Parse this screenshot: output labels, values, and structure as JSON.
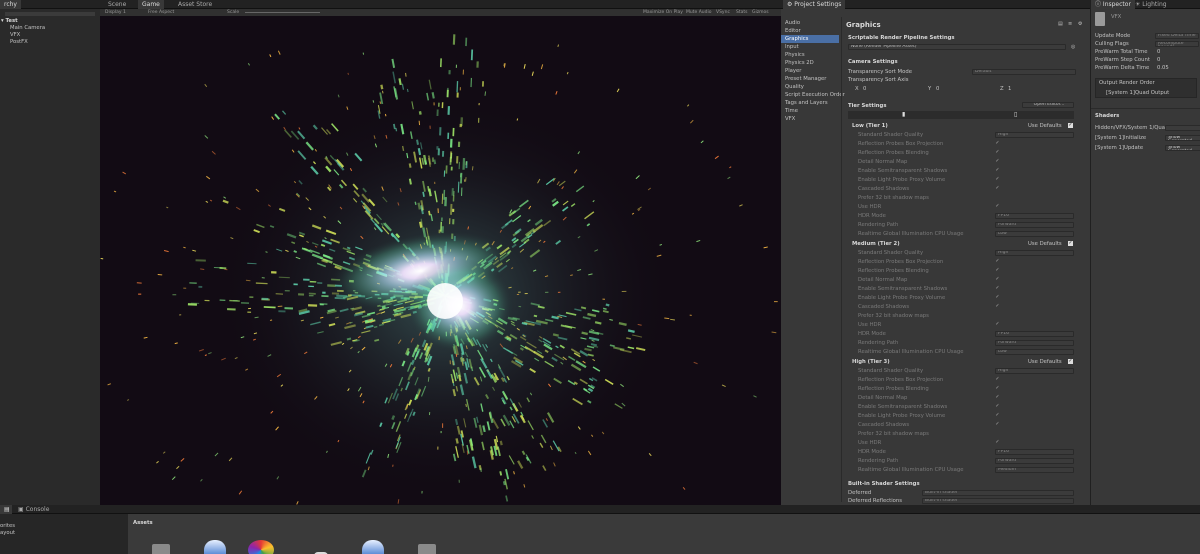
{
  "hierarchy": {
    "tab": "rchy",
    "scene_name": "Test",
    "items": [
      "Main Camera",
      "VFX",
      "PostFX"
    ]
  },
  "center_tabs": {
    "scene": "Scene",
    "game": "Game",
    "asset_store": "Asset Store"
  },
  "game_toolbar": {
    "display": "Display 1",
    "aspect": "Free Aspect",
    "scale_label": "Scale",
    "maximize": "Maximize On Play",
    "mute": "Mute Audio",
    "vsync": "VSync",
    "stats": "Stats",
    "gizmos": "Gizmos"
  },
  "project_settings": {
    "tab": "Project Settings",
    "categories": [
      "Audio",
      "Editor",
      "Graphics",
      "Input",
      "Physics",
      "Physics 2D",
      "Player",
      "Preset Manager",
      "Quality",
      "Script Execution Order",
      "Tags and Layers",
      "Time",
      "VFX"
    ],
    "selected_index": 2,
    "header": "Graphics",
    "srp_section": "Scriptable Render Pipeline Settings",
    "srp_value": "None (Render Pipeline Asset)",
    "camera_section": "Camera Settings",
    "transparency_sort_mode_label": "Transparency Sort Mode",
    "transparency_sort_mode_value": "Default",
    "transparency_sort_axis_label": "Transparency Sort Axis",
    "axis": {
      "x_label": "X",
      "x_value": "0",
      "y_label": "Y",
      "y_value": "0",
      "z_label": "Z",
      "z_value": "1"
    },
    "tier_section": "Tier Settings",
    "open_editor": "Open Editor...",
    "use_defaults": "Use Defaults",
    "tiers": [
      {
        "name": "Low (Tier 1)",
        "rows": [
          {
            "label": "Standard Shader Quality",
            "value": "High"
          },
          {
            "label": "Reflection Probes Box Projection",
            "check": true
          },
          {
            "label": "Reflection Probes Blending",
            "check": true
          },
          {
            "label": "Detail Normal Map",
            "check": true
          },
          {
            "label": "Enable Semitransparent Shadows",
            "check": true
          },
          {
            "label": "Enable Light Probe Proxy Volume",
            "check": true
          },
          {
            "label": "Cascaded Shadows",
            "check": true
          },
          {
            "label": "Prefer 32 bit shadow maps",
            "check": false
          },
          {
            "label": "Use HDR",
            "check": true
          },
          {
            "label": "HDR Mode",
            "value": "FP16"
          },
          {
            "label": "Rendering Path",
            "value": "Forward"
          },
          {
            "label": "Realtime Global Illumination CPU Usage",
            "value": "Low"
          }
        ]
      },
      {
        "name": "Medium (Tier 2)",
        "rows": [
          {
            "label": "Standard Shader Quality",
            "value": "High"
          },
          {
            "label": "Reflection Probes Box Projection",
            "check": true
          },
          {
            "label": "Reflection Probes Blending",
            "check": true
          },
          {
            "label": "Detail Normal Map",
            "check": true
          },
          {
            "label": "Enable Semitransparent Shadows",
            "check": true
          },
          {
            "label": "Enable Light Probe Proxy Volume",
            "check": true
          },
          {
            "label": "Cascaded Shadows",
            "check": true
          },
          {
            "label": "Prefer 32 bit shadow maps",
            "check": false
          },
          {
            "label": "Use HDR",
            "check": true
          },
          {
            "label": "HDR Mode",
            "value": "FP16"
          },
          {
            "label": "Rendering Path",
            "value": "Forward"
          },
          {
            "label": "Realtime Global Illumination CPU Usage",
            "value": "Low"
          }
        ]
      },
      {
        "name": "High (Tier 3)",
        "rows": [
          {
            "label": "Standard Shader Quality",
            "value": "High"
          },
          {
            "label": "Reflection Probes Box Projection",
            "check": true
          },
          {
            "label": "Reflection Probes Blending",
            "check": true
          },
          {
            "label": "Detail Normal Map",
            "check": true
          },
          {
            "label": "Enable Semitransparent Shadows",
            "check": true
          },
          {
            "label": "Enable Light Probe Proxy Volume",
            "check": true
          },
          {
            "label": "Cascaded Shadows",
            "check": true
          },
          {
            "label": "Prefer 32 bit shadow maps",
            "check": false
          },
          {
            "label": "Use HDR",
            "check": true
          },
          {
            "label": "HDR Mode",
            "value": "FP16"
          },
          {
            "label": "Rendering Path",
            "value": "Forward"
          },
          {
            "label": "Realtime Global Illumination CPU Usage",
            "value": "Medium"
          }
        ]
      }
    ],
    "builtin_section": "Built-in Shader Settings",
    "builtin_rows": [
      {
        "label": "Deferred",
        "value": "Built-in shader"
      },
      {
        "label": "Deferred Reflections",
        "value": "Built-in shader"
      }
    ]
  },
  "inspector": {
    "tab": "Inspector",
    "lighting_tab": "Lighting",
    "object_name": "VFX",
    "rows": [
      {
        "label": "Update Mode",
        "value": "Fixed Delta Time"
      },
      {
        "label": "Culling Flags",
        "value": "Recompute bounds"
      },
      {
        "label": "PreWarm Total Time",
        "value": "0"
      },
      {
        "label": "PreWarm Step Count",
        "value": "0"
      },
      {
        "label": "PreWarm Delta Time",
        "value": "0.05"
      }
    ],
    "output_render_order": "Output Render Order",
    "output_item": "[System 1]Quad Output",
    "shaders_section": "Shaders",
    "shader_rows": [
      {
        "label": "Hidden/VFX/System 1/Quad Output",
        "button": ""
      },
      {
        "label": "[System 1]Initialize",
        "button": "Show Generated"
      },
      {
        "label": "[System 1]Update",
        "button": "Show Generated"
      }
    ]
  },
  "bottom": {
    "console_tab": "Console",
    "favorites": "orites",
    "layout": "ayout",
    "assets": "Assets"
  },
  "colors": {
    "accent": "#4a6fa5",
    "panel": "#383838",
    "dark": "#1f1f1f",
    "viewport": "#120b14"
  }
}
